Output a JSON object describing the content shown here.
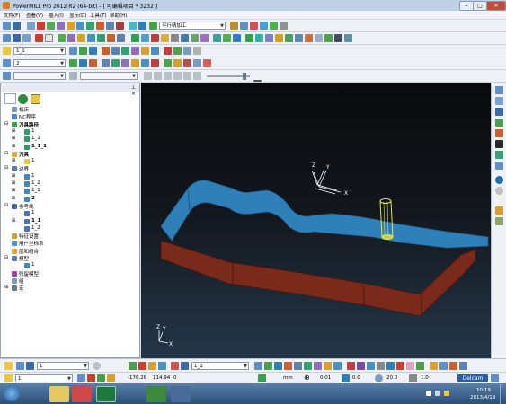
{
  "window": {
    "title": "PowerMILL Pro 2012 R2 (64-bit)   - [ 可编辑项目 * 3232 ]"
  },
  "menu": [
    "文件(F)",
    "查看(V)",
    "插入(I)",
    "显示(D)",
    "工具(T)",
    "帮助(H)"
  ],
  "toolbar": {
    "strategy_select": "平行精加工",
    "toolpath_select": "1_1",
    "tool_select": "2",
    "bottom_combo_1": "1",
    "bottom_combo_2": "1_1",
    "bottom_combo_3": "1"
  },
  "explorer": {
    "items": [
      {
        "label": "机床",
        "level": 0,
        "icon": "machine-icon",
        "bold": false,
        "expander": ""
      },
      {
        "label": "NC程序",
        "level": 0,
        "icon": "nc-program-icon",
        "bold": false,
        "expander": ""
      },
      {
        "label": "刀具路径",
        "level": 0,
        "icon": "toolpath-folder-icon",
        "bold": true,
        "expander": "−"
      },
      {
        "label": "1",
        "level": 1,
        "icon": "toolpath-icon",
        "bold": false,
        "expander": "+"
      },
      {
        "label": "1_1",
        "level": 1,
        "icon": "toolpath-icon",
        "bold": false,
        "expander": "+"
      },
      {
        "label": "1_1_1",
        "level": 1,
        "icon": "toolpath-icon",
        "bold": true,
        "expander": "+"
      },
      {
        "label": "刀具",
        "level": 0,
        "icon": "tool-folder-icon",
        "bold": true,
        "expander": "−"
      },
      {
        "label": "1",
        "level": 1,
        "icon": "tool-icon",
        "bold": false,
        "expander": "+"
      },
      {
        "label": "边界",
        "level": 0,
        "icon": "boundary-folder-icon",
        "bold": false,
        "expander": "−"
      },
      {
        "label": "1",
        "level": 1,
        "icon": "boundary-icon",
        "bold": false,
        "expander": "+"
      },
      {
        "label": "1_2",
        "level": 1,
        "icon": "boundary-icon",
        "bold": false,
        "expander": "+"
      },
      {
        "label": "1_1",
        "level": 1,
        "icon": "boundary-icon",
        "bold": false,
        "expander": "+"
      },
      {
        "label": "2",
        "level": 1,
        "icon": "boundary-icon",
        "bold": true,
        "expander": "+"
      },
      {
        "label": "参考线",
        "level": 0,
        "icon": "pattern-folder-icon",
        "bold": false,
        "expander": "−"
      },
      {
        "label": "1",
        "level": 1,
        "icon": "pattern-icon",
        "bold": false,
        "expander": ""
      },
      {
        "label": "1_1",
        "level": 1,
        "icon": "pattern-icon",
        "bold": true,
        "expander": "+"
      },
      {
        "label": "1_2",
        "level": 1,
        "icon": "pattern-icon",
        "bold": false,
        "expander": ""
      },
      {
        "label": "特征设置",
        "level": 0,
        "icon": "feature-icon",
        "bold": false,
        "expander": ""
      },
      {
        "label": "用户坐标系",
        "level": 0,
        "icon": "workplane-icon",
        "bold": false,
        "expander": ""
      },
      {
        "label": "层和组合",
        "level": 0,
        "icon": "layer-icon",
        "bold": false,
        "expander": ""
      },
      {
        "label": "模型",
        "level": 0,
        "icon": "model-folder-icon",
        "bold": false,
        "expander": "−"
      },
      {
        "label": "1",
        "level": 1,
        "icon": "model-icon",
        "bold": false,
        "expander": ""
      },
      {
        "label": "残留模型",
        "level": 0,
        "icon": "stock-model-icon",
        "bold": false,
        "expander": ""
      },
      {
        "label": "组",
        "level": 0,
        "icon": "group-icon",
        "bold": false,
        "expander": ""
      },
      {
        "label": "宏",
        "level": 0,
        "icon": "macro-icon",
        "bold": false,
        "expander": "+"
      }
    ]
  },
  "viewport": {
    "axis_labels": {
      "x": "X",
      "y": "Y",
      "z": "Z"
    },
    "logo": "Delcam"
  },
  "status": {
    "coord_x": "-176.26",
    "coord_y": "114.94",
    "coord_z": "0",
    "units": "mm",
    "tolerance": "0.01",
    "thickness": "0.0",
    "stepover": "20.0",
    "depth": "1.0"
  },
  "taskbar": {
    "time": "10:19",
    "date": "2013/4/19"
  },
  "colors": {
    "upper_part": "#2f7fb8",
    "lower_part": "#7a2a1a",
    "tool": "#e0e84a",
    "accent": "#2b5da8"
  }
}
